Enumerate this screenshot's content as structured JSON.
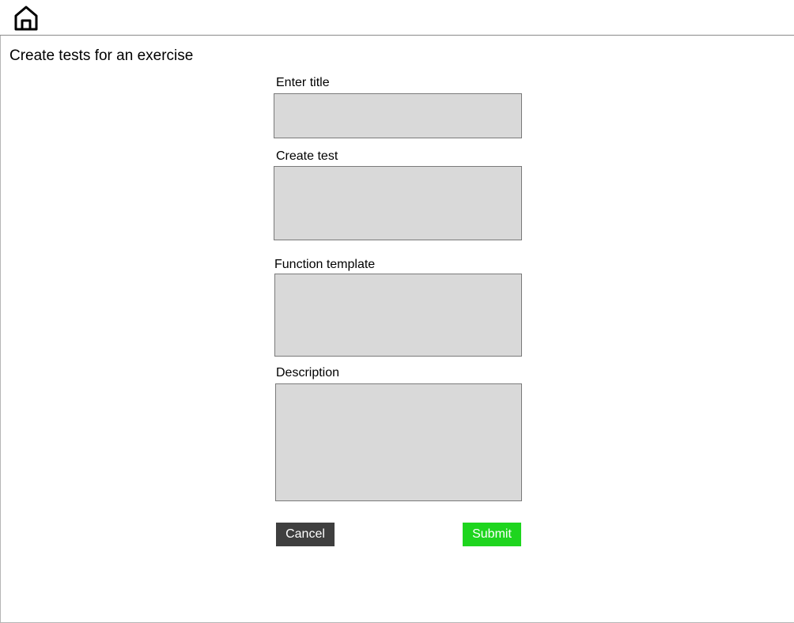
{
  "header": {
    "home_icon": "home-icon"
  },
  "page": {
    "title": "Create tests for an exercise"
  },
  "form": {
    "title_label": "Enter title",
    "title_value": "",
    "test_label": "Create test",
    "test_value": "",
    "template_label": "Function template",
    "template_value": "",
    "description_label": "Description",
    "description_value": "",
    "cancel_label": "Cancel",
    "submit_label": "Submit"
  },
  "colors": {
    "field_background": "#d9d9d9",
    "cancel_background": "#3f3f3f",
    "submit_background": "#1ed51e"
  }
}
